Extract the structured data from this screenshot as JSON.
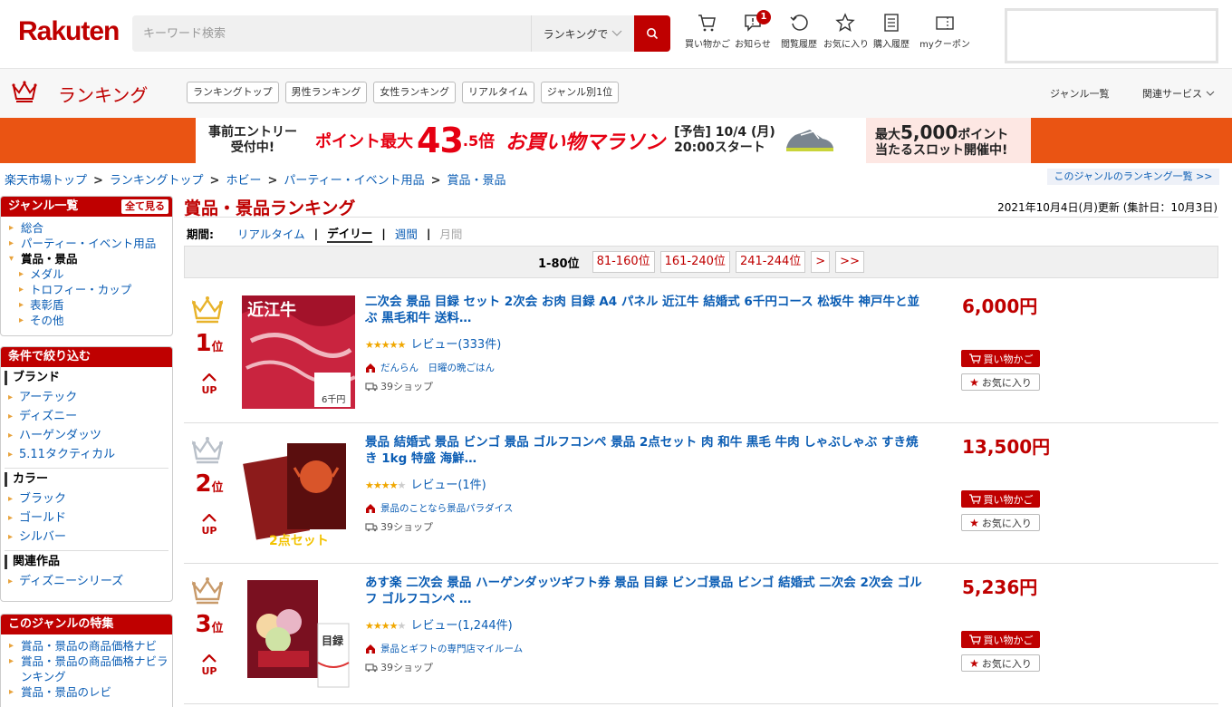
{
  "header": {
    "logo": "Rakuten",
    "search_placeholder": "キーワード検索",
    "search_scope": "ランキングで",
    "icons": [
      {
        "label": "買い物かご"
      },
      {
        "label": "お知らせ",
        "badge": "1"
      },
      {
        "label": "閲覧履歴"
      },
      {
        "label": "お気に入り"
      },
      {
        "label": "購入履歴"
      },
      {
        "label": "myクーポン"
      }
    ]
  },
  "ranking_nav": {
    "title": "ランキング",
    "tabs": [
      "ランキングトップ",
      "男性ランキング",
      "女性ランキング",
      "リアルタイム",
      "ジャンル別1位"
    ],
    "genre_list": "ジャンル一覧",
    "related": "関連サービス"
  },
  "banner": {
    "entry_line1": "事前エントリー",
    "entry_line2": "受付中!",
    "point_label": "ポイント最大",
    "point_int": "43",
    "point_dec": ".5",
    "point_unit": "倍",
    "marathon": "お買い物マラソン",
    "date_line1": "[予告] 10/4 (月)",
    "date_line2": "20:00スタート",
    "right_line1_pre": "最大",
    "right_line1_num": "5,000",
    "right_line1_post": "ポイント",
    "right_line2": "当たるスロット開催中!"
  },
  "breadcrumb": {
    "items": [
      "楽天市場トップ",
      "ランキングトップ",
      "ホビー",
      "パーティー・イベント用品",
      "賞品・景品"
    ],
    "sep": ">",
    "right_link": "このジャンルのランキング一覧 >>"
  },
  "sidebar": {
    "genre": {
      "title": "ジャンル一覧",
      "all_label": "全て見る",
      "items": [
        {
          "label": "総合"
        },
        {
          "label": "パーティー・イベント用品"
        },
        {
          "label": "賞品・景品"
        },
        {
          "label": "メダル"
        },
        {
          "label": "トロフィー・カップ"
        },
        {
          "label": "表彰盾"
        },
        {
          "label": "その他"
        }
      ]
    },
    "conditions": {
      "title": "条件で絞り込む",
      "groups": [
        {
          "title": "ブランド",
          "items": [
            "アーテック",
            "ディズニー",
            "ハーゲンダッツ",
            "5.11タクティカル"
          ]
        },
        {
          "title": "カラー",
          "items": [
            "ブラック",
            "ゴールド",
            "シルバー"
          ]
        },
        {
          "title": "関連作品",
          "items": [
            "ディズニーシリーズ"
          ]
        }
      ]
    },
    "features": {
      "title": "このジャンルの特集",
      "items": [
        "賞品・景品の商品価格ナビ",
        "賞品・景品の商品価格ナビランキング",
        "賞品・景品のレビ"
      ]
    }
  },
  "main": {
    "title": "賞品・景品ランキング",
    "updated": "2021年10月4日(月)更新 (集計日：10月3日)",
    "period": {
      "label": "期間:",
      "realtime": "リアルタイム",
      "daily": "デイリー",
      "weekly": "週間",
      "monthly": "月間",
      "pipe": "|"
    },
    "pager": {
      "current": "1-80位",
      "pages": [
        "81-160位",
        "161-240位",
        "241-244位",
        ">",
        ">>"
      ]
    },
    "items": [
      {
        "rank": "1",
        "rank_suffix": "位",
        "trend": "UP",
        "title": "二次会 景品 目録 セット 2次会 お肉 目録 A4 パネル 近江牛 結婚式 6千円コース 松坂牛 神戸牛と並ぶ 黒毛和牛 送料…",
        "stars": 4.5,
        "reviews": "レビュー(333件)",
        "shop": "だんらん　日曜の晩ごはん",
        "shipping": "39ショップ",
        "price": "6,000円",
        "thumb_text": "近江牛",
        "thumb_sub": "6千円",
        "crown_color": "#e8b32b"
      },
      {
        "rank": "2",
        "rank_suffix": "位",
        "trend": "UP",
        "title": "景品 結婚式 景品 ビンゴ 景品 ゴルフコンペ 景品 2点セット 肉 和牛 黒毛 牛肉 しゃぶしゃぶ すき焼き 1kg 特盛 海鮮…",
        "stars": 4,
        "reviews": "レビュー(1件)",
        "shop": "景品のことなら景品パラダイス",
        "shipping": "39ショップ",
        "price": "13,500円",
        "thumb_text": "2点セット",
        "thumb_sub": "",
        "crown_color": "#b9c0c9"
      },
      {
        "rank": "3",
        "rank_suffix": "位",
        "trend": "UP",
        "title": "あす楽 二次会 景品 ハーゲンダッツギフト券 景品 目録 ビンゴ景品 ビンゴ 結婚式 二次会 2次会 ゴルフ ゴルフコンペ …",
        "stars": 4,
        "reviews": "レビュー(1,244件)",
        "shop": "景品とギフトの専門店マイルーム",
        "shipping": "39ショップ",
        "price": "5,236円",
        "thumb_text": "目録",
        "thumb_sub": "",
        "crown_color": "#c89a6a"
      }
    ],
    "cart_label": "買い物かご",
    "fav_label": "お気に入り"
  }
}
